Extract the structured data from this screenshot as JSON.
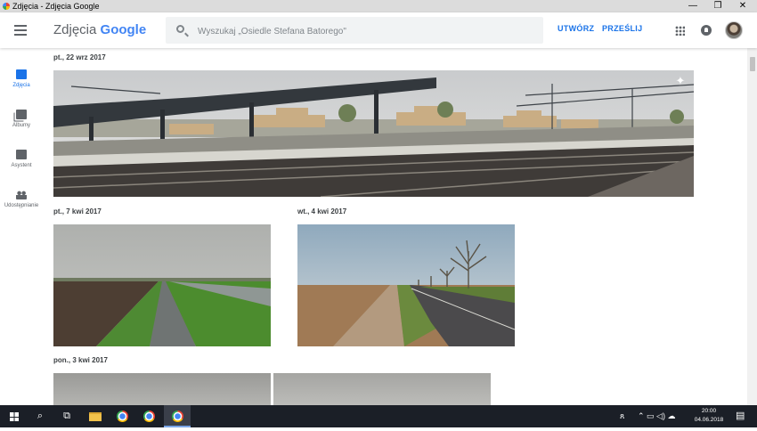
{
  "window": {
    "title": "Zdjęcia - Zdjęcia Google",
    "minimize_glyph": "—",
    "restore_glyph": "❐",
    "close_glyph": "✕"
  },
  "header": {
    "menu_icon": "hamburger-menu-icon",
    "logo_word": "Zdjęcia",
    "logo_brand": "Google",
    "search_placeholder": "Wyszukaj „Osiedle Stefana Batorego\"",
    "create_label": "UTWÓRZ",
    "upload_label": "PRZEŚLIJ",
    "apps_icon": "apps-grid-icon",
    "notifications_icon": "bell-icon",
    "accent_color": "#1a73e8"
  },
  "sidebar": {
    "items": [
      {
        "label": "Zdjęcia",
        "icon": "photo-icon",
        "active": true
      },
      {
        "label": "Albumy",
        "icon": "album-icon",
        "active": false
      },
      {
        "label": "Asystent",
        "icon": "assistant-icon",
        "active": false
      },
      {
        "label": "Udostępnianie",
        "icon": "sharing-icon",
        "active": false
      }
    ]
  },
  "groups": [
    {
      "date": "pt., 22 wrz 2017",
      "photos": [
        {
          "subject": "railway station panorama with tanks on train"
        }
      ]
    },
    {
      "date": "pt., 7 kwi 2017",
      "photos": [
        {
          "subject": "path through fields under cloudy sky"
        }
      ]
    },
    {
      "date": "wt., 4 kwi 2017",
      "photos": [
        {
          "subject": "country road with bare trees"
        }
      ]
    },
    {
      "date": "pon., 3 kwi 2017",
      "photos": [
        {
          "subject": "overcast sky"
        },
        {
          "subject": "overcast sky"
        }
      ]
    }
  ],
  "taskbar": {
    "clock_time": "20:00",
    "clock_date": "04.06.2018",
    "search_glyph": "⌕",
    "task_view_glyph": "⧉",
    "people_glyph": "ጸ",
    "tray_glyphs": "⌃ ▭ ◁) ☁",
    "notification_glyph": "▤"
  }
}
